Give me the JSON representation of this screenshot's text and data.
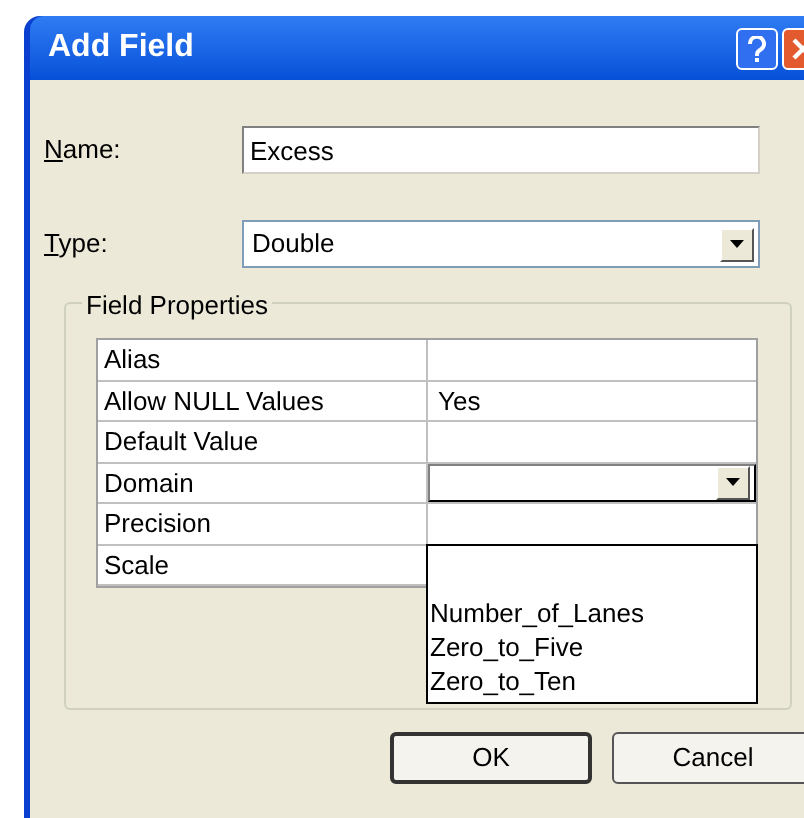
{
  "window": {
    "title": "Add Field"
  },
  "name_field": {
    "label": "Name:",
    "value": "Excess"
  },
  "type_field": {
    "label": "Type:",
    "value": "Double"
  },
  "field_properties": {
    "title": "Field Properties",
    "rows": [
      {
        "property": "Alias",
        "kind": "text"
      },
      {
        "property": "Allow NULL Values",
        "value": "Yes",
        "kind": "text"
      },
      {
        "property": "Default Value",
        "kind": "text"
      },
      {
        "property": "Domain",
        "kind": "dropdown"
      },
      {
        "property": "Precision",
        "kind": "text"
      },
      {
        "property": "Scale",
        "kind": "text"
      }
    ],
    "domain_options": [
      "Number_of_Lanes",
      "Zero_to_Five",
      "Zero_to_Ten"
    ]
  },
  "buttons": [
    {
      "label": "OK",
      "default": true
    },
    {
      "label": "Cancel",
      "default": false
    }
  ]
}
